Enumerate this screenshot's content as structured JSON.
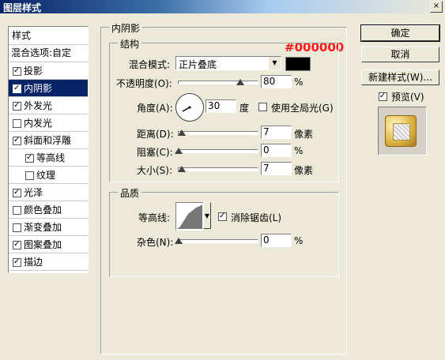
{
  "window": {
    "title": "图层样式",
    "close_glyph": "×"
  },
  "annotation": "#000000",
  "style_list": {
    "header": "样式",
    "blend_options": "混合选项:自定",
    "items": [
      {
        "label": "投影",
        "checked": true,
        "sub": false,
        "selected": false
      },
      {
        "label": "内阴影",
        "checked": true,
        "sub": false,
        "selected": true
      },
      {
        "label": "外发光",
        "checked": true,
        "sub": false,
        "selected": false
      },
      {
        "label": "内发光",
        "checked": false,
        "sub": false,
        "selected": false
      },
      {
        "label": "斜面和浮雕",
        "checked": true,
        "sub": false,
        "selected": false
      },
      {
        "label": "等高线",
        "checked": true,
        "sub": true,
        "selected": false
      },
      {
        "label": "纹理",
        "checked": false,
        "sub": true,
        "selected": false
      },
      {
        "label": "光泽",
        "checked": true,
        "sub": false,
        "selected": false
      },
      {
        "label": "颜色叠加",
        "checked": false,
        "sub": false,
        "selected": false
      },
      {
        "label": "渐变叠加",
        "checked": false,
        "sub": false,
        "selected": false
      },
      {
        "label": "图案叠加",
        "checked": true,
        "sub": false,
        "selected": false
      },
      {
        "label": "描边",
        "checked": true,
        "sub": false,
        "selected": false
      }
    ]
  },
  "inner_shadow": {
    "title": "内阴影",
    "structure": {
      "title": "结构",
      "blend_mode_label": "混合模式:",
      "blend_mode_value": "正片叠底",
      "shadow_color": "#000000",
      "opacity_label": "不透明度(O):",
      "opacity_value": "80",
      "opacity_unit": "%",
      "angle_label": "角度(A):",
      "angle_value": "30",
      "angle_unit": "度",
      "global_light_label": "使用全局光(G)",
      "global_light_checked": false,
      "distance_label": "距离(D):",
      "distance_value": "7",
      "distance_unit": "像素",
      "choke_label": "阻塞(C):",
      "choke_value": "0",
      "choke_unit": "%",
      "size_label": "大小(S):",
      "size_value": "7",
      "size_unit": "像素"
    },
    "quality": {
      "title": "品质",
      "contour_label": "等高线:",
      "anti_alias_label": "消除锯齿(L)",
      "anti_alias_checked": true,
      "noise_label": "杂色(N):",
      "noise_value": "0",
      "noise_unit": "%"
    }
  },
  "buttons": {
    "ok": "确定",
    "cancel": "取消",
    "new_style": "新建样式(W)...",
    "preview_label": "预览(V)",
    "preview_checked": true
  }
}
